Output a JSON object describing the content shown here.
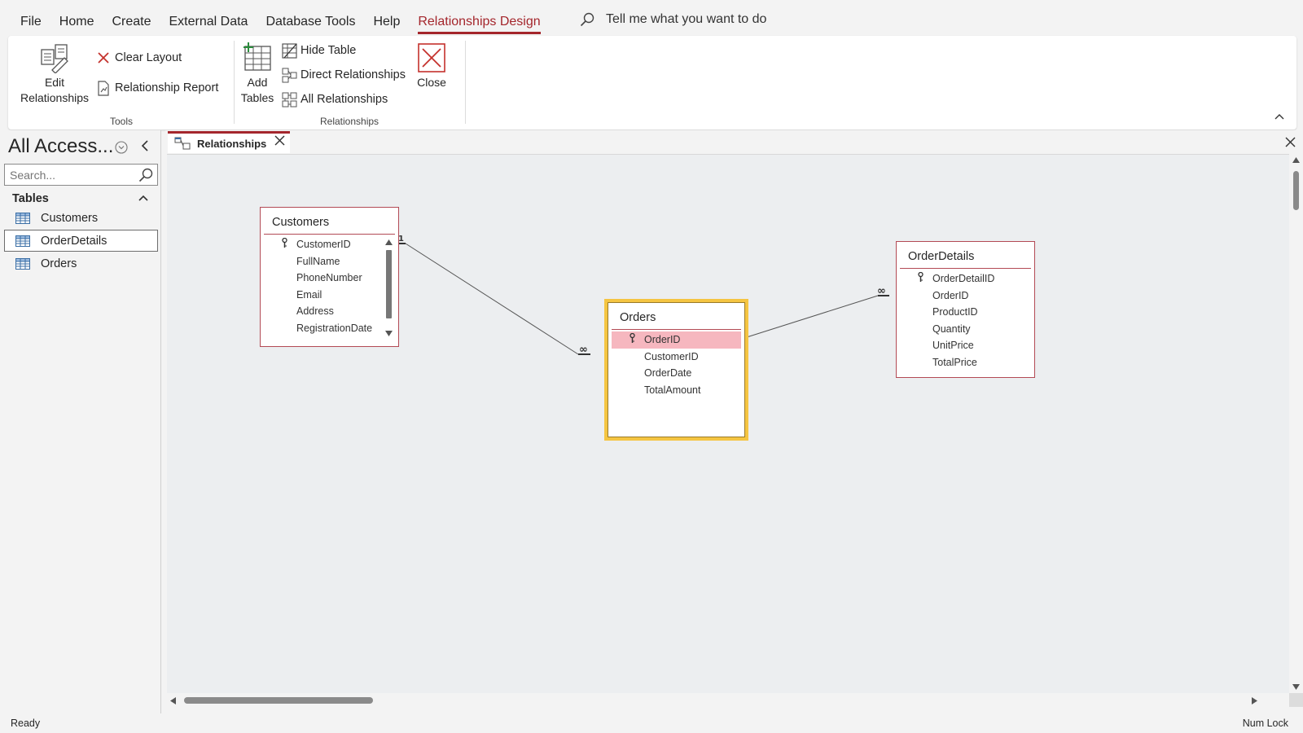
{
  "menu": {
    "items": [
      "File",
      "Home",
      "Create",
      "External Data",
      "Database Tools",
      "Help",
      "Relationships Design"
    ],
    "tell_me": "Tell me what you want to do"
  },
  "ribbon": {
    "tools": {
      "label": "Tools",
      "edit_relationships": "Edit Relationships",
      "clear_layout": "Clear Layout",
      "relationship_report": "Relationship Report"
    },
    "relationships": {
      "label": "Relationships",
      "add_tables": "Add Tables",
      "hide_table": "Hide Table",
      "direct_relationships": "Direct Relationships",
      "all_relationships": "All Relationships",
      "close": "Close"
    }
  },
  "nav": {
    "title": "All Access...",
    "search_placeholder": "Search...",
    "group": "Tables",
    "items": [
      "Customers",
      "OrderDetails",
      "Orders"
    ],
    "selected": "OrderDetails"
  },
  "document": {
    "tab_label": "Relationships"
  },
  "tables": {
    "customers": {
      "title": "Customers",
      "fields": [
        "CustomerID",
        "FullName",
        "PhoneNumber",
        "Email",
        "Address",
        "RegistrationDate"
      ]
    },
    "orders": {
      "title": "Orders",
      "fields": [
        "OrderID",
        "CustomerID",
        "OrderDate",
        "TotalAmount"
      ]
    },
    "orderdetails": {
      "title": "OrderDetails",
      "fields": [
        "OrderDetailID",
        "OrderID",
        "ProductID",
        "Quantity",
        "UnitPrice",
        "TotalPrice"
      ]
    }
  },
  "relationships": {
    "one_label": "1",
    "many_label": "∞"
  },
  "status": {
    "left": "Ready",
    "right": "Num Lock"
  },
  "colors": {
    "accent": "#a4262c",
    "selected_field": "#f6b7bf",
    "active_table_outline": "#f5c542"
  }
}
